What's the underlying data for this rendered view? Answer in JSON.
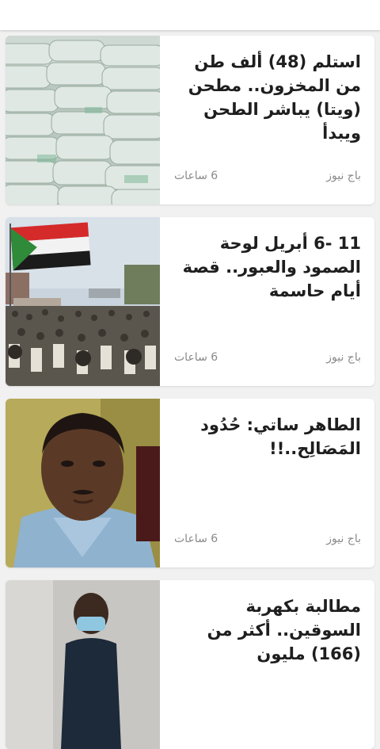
{
  "articles": [
    {
      "title": "استلم (48) ألف طن من المخزون.. مطحن (ويتا) يباشر الطحن ويبدأ",
      "source": "باج نيوز",
      "time": "6 ساعات",
      "image": "flour-sacks-photo"
    },
    {
      "title": "11 -6 أبريل لوحة الصمود والعبور.. قصة أيام حاسمة",
      "source": "باج نيوز",
      "time": "6 ساعات",
      "image": "crowd-with-flag-photo"
    },
    {
      "title": "الطاهر ساتي: حُدُود المَصَالِح..!!",
      "source": "باج نيوز",
      "time": "6 ساعات",
      "image": "man-portrait-photo"
    },
    {
      "title": "مطالبة بكهربة السوقين.. أكثر من (166) مليون",
      "source": "",
      "time": "",
      "image": "masked-man-photo"
    }
  ]
}
